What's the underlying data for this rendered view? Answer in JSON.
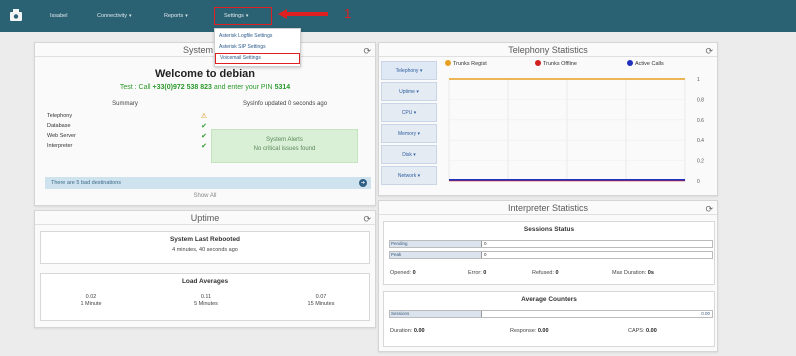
{
  "nav": {
    "items": [
      "Issabel",
      "Connectivity",
      "Reports",
      "Settings"
    ],
    "settings_menu": [
      "Asterisk Logfile Settings",
      "Asterisk SIP Settings",
      "Voicemail Settings"
    ],
    "callout_1": "1",
    "callout_2": "2"
  },
  "system_overview": {
    "title": "System Ov",
    "welcome": "Welcome to debian",
    "call_prefix": "Test : Call ",
    "call_number": "+33(0)972 538 823",
    "call_mid": " and enter your PIN ",
    "call_pin": "5314",
    "summary_head": "Summary",
    "sysinfo_head": "SysInfo updated 0 seconds ago",
    "summary": [
      {
        "label": "Telephony",
        "status": "warning"
      },
      {
        "label": "Database",
        "status": "ok"
      },
      {
        "label": "Web Server",
        "status": "ok"
      },
      {
        "label": "Interpreter",
        "status": "ok"
      }
    ],
    "alerts_title": "System Alerts",
    "alerts_text": "No critical issues found",
    "info": "There are 5 bad destinations",
    "show_all": "Show All"
  },
  "uptime": {
    "title": "Uptime",
    "reboot_head": "System Last Rebooted",
    "reboot_value": "4 minutes, 40 seconds ago",
    "load_head": "Load Averages",
    "loads": [
      {
        "value": "0.02",
        "label": "1 Minute"
      },
      {
        "value": "0.11",
        "label": "5 Minutes"
      },
      {
        "value": "0.07",
        "label": "15 Minutes"
      }
    ]
  },
  "telephony": {
    "title": "Telephony Statistics",
    "tabs": [
      "Telephony ▾",
      "Uptime ▾",
      "CPU ▾",
      "Memory ▾",
      "Disk ▾",
      "Network ▾"
    ],
    "legend": [
      "Trunks Regist",
      "Trunks Offline",
      "Active Calls"
    ],
    "y_ticks": [
      "1",
      "0.8",
      "0.6",
      "0.4",
      "0.2",
      "0"
    ]
  },
  "chart_data": {
    "type": "line",
    "title": "",
    "ylim": [
      0,
      1
    ],
    "series": [
      {
        "name": "Trunks Regist",
        "color": "#e8a020",
        "values": [
          1,
          1,
          1,
          1,
          1,
          1
        ]
      },
      {
        "name": "Trunks Offline",
        "color": "#d02020",
        "values": [
          0,
          0,
          0,
          0,
          0,
          0
        ]
      },
      {
        "name": "Active Calls",
        "color": "#2030c0",
        "values": [
          0,
          0,
          0,
          0,
          0,
          0
        ]
      }
    ]
  },
  "interpreter": {
    "title": "Interpreter Statistics",
    "sessions_head": "Sessions Status",
    "pending_label": "Pending",
    "pending_value": "0",
    "peak_label": "Peak",
    "peak_value": "0",
    "opened_label": "Opened:",
    "opened": "0",
    "error_label": "Error:",
    "error": "0",
    "refused_label": "Refused:",
    "refused": "0",
    "maxdur_label": "Max Duration:",
    "maxdur": "0s",
    "counters_head": "Average Counters",
    "sessions_label": "Sessions",
    "sessions_value": "0.00",
    "duration_label": "Duration:",
    "duration": "0.00",
    "response_label": "Response:",
    "response": "0.00",
    "caps_label": "CAPS:",
    "caps": "0.00"
  },
  "colors": {
    "topbar": "#2b6273",
    "callout": "#e02020",
    "accent": "#2d5a8c"
  }
}
